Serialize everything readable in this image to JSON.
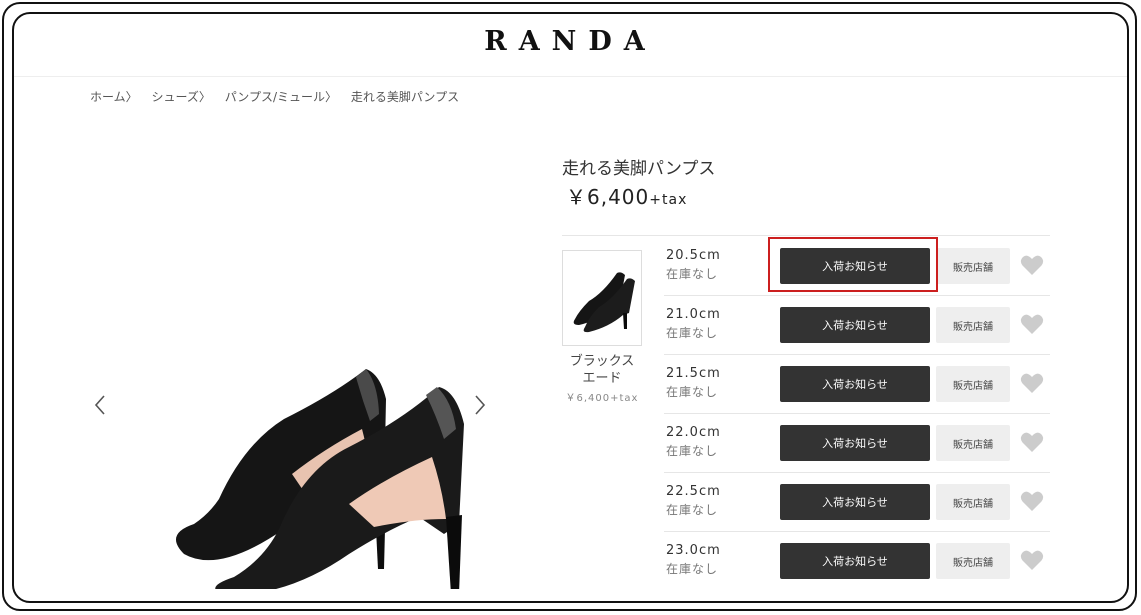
{
  "header": {
    "logo": "RANDA"
  },
  "breadcrumb": [
    {
      "label": "ホーム〉"
    },
    {
      "label": "シューズ〉"
    },
    {
      "label": "パンプス/ミュール〉"
    },
    {
      "label": "走れる美脚パンプス"
    }
  ],
  "gallery": {
    "prev_icon": "chevron-left-icon",
    "next_icon": "chevron-right-icon"
  },
  "product": {
    "title": "走れる美脚パンプス",
    "price": "￥6,400",
    "tax": "+tax"
  },
  "color": {
    "name_line1": "ブラックス",
    "name_line2": "エード",
    "price": "￥6,400+tax"
  },
  "sizes": [
    {
      "size": "20.5cm",
      "stock": "在庫なし",
      "notify": "入荷お知らせ",
      "store": "販売店舗"
    },
    {
      "size": "21.0cm",
      "stock": "在庫なし",
      "notify": "入荷お知らせ",
      "store": "販売店舗"
    },
    {
      "size": "21.5cm",
      "stock": "在庫なし",
      "notify": "入荷お知らせ",
      "store": "販売店舗"
    },
    {
      "size": "22.0cm",
      "stock": "在庫なし",
      "notify": "入荷お知らせ",
      "store": "販売店舗"
    },
    {
      "size": "22.5cm",
      "stock": "在庫なし",
      "notify": "入荷お知らせ",
      "store": "販売店舗"
    },
    {
      "size": "23.0cm",
      "stock": "在庫なし",
      "notify": "入荷お知らせ",
      "store": "販売店舗"
    }
  ],
  "colors": {
    "button_dark": "#333333",
    "button_light": "#eeeeee",
    "heart": "#cccccc",
    "highlight": "#cc1f1f"
  }
}
